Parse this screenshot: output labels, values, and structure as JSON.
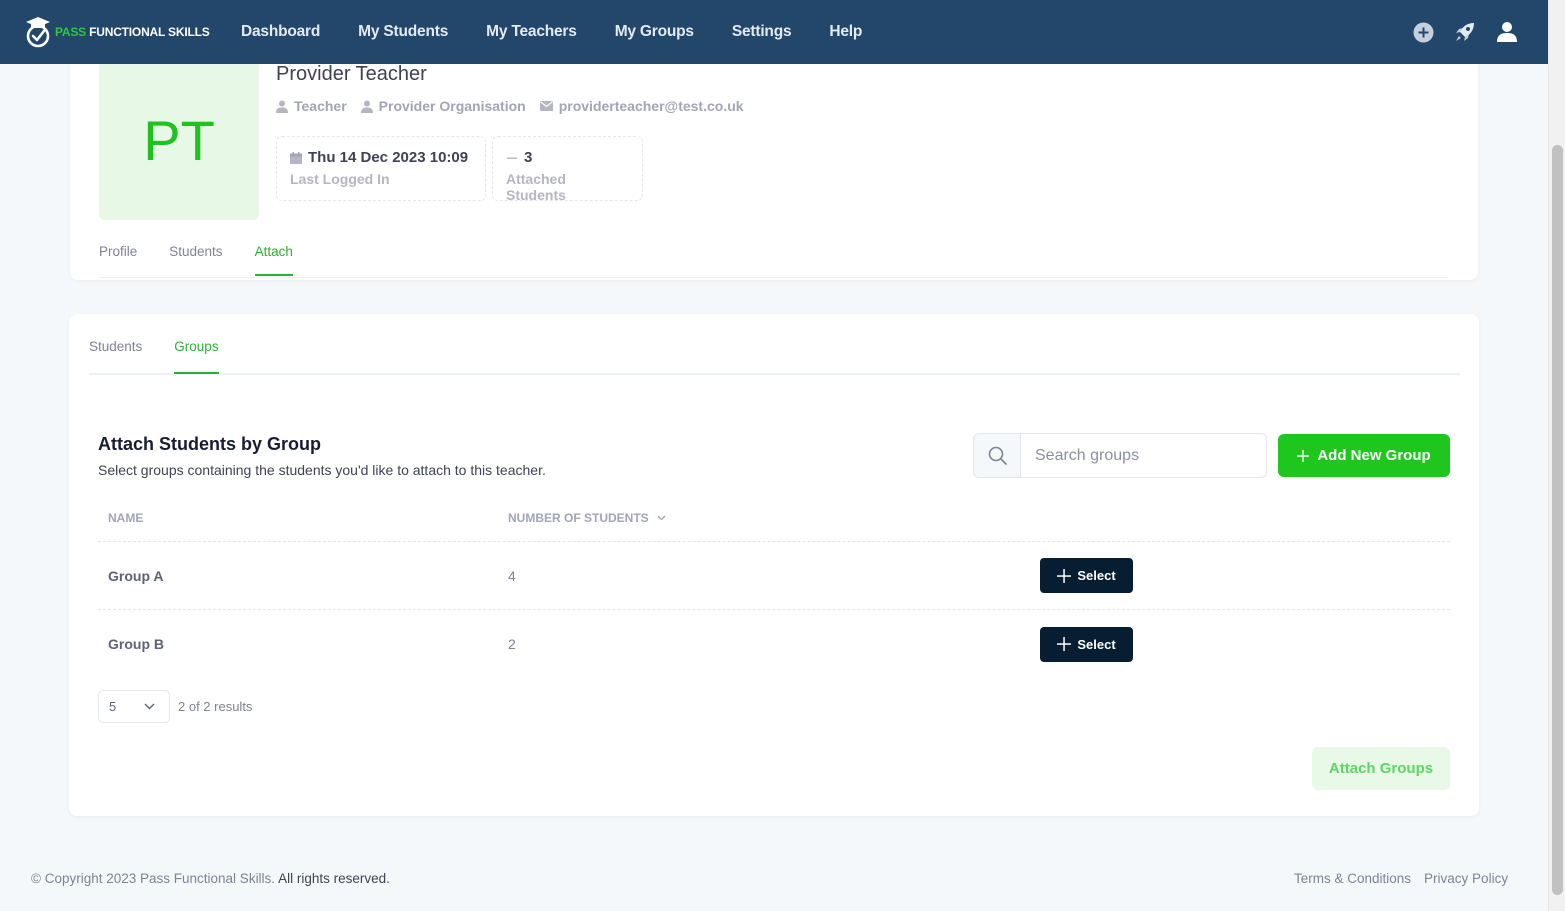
{
  "navbar": {
    "brand_accent": "PASS",
    "brand_rest": "FUNCTIONAL SKILLS",
    "items": [
      {
        "label": "Dashboard"
      },
      {
        "label": "My Students"
      },
      {
        "label": "My Teachers"
      },
      {
        "label": "My Groups"
      },
      {
        "label": "Settings"
      },
      {
        "label": "Help"
      }
    ],
    "icons": [
      "plus-circle-icon",
      "rocket-icon",
      "user-icon"
    ]
  },
  "profile": {
    "initials": "PT",
    "name": "Provider Teacher",
    "role": "Teacher",
    "organisation": "Provider Organisation",
    "email": "providerteacher@test.co.uk",
    "last_logged_in_value": "Thu 14 Dec 2023 10:09",
    "last_logged_in_label": "Last Logged In",
    "attached_students_value": "3",
    "attached_students_label": "Attached Students",
    "tabs": [
      "Profile",
      "Students",
      "Attach"
    ],
    "active_tab": "Attach"
  },
  "attach": {
    "tabs": [
      "Students",
      "Groups"
    ],
    "active_tab": "Groups",
    "title": "Attach Students by Group",
    "description": "Select groups containing the students you'd like to attach to this teacher.",
    "search_placeholder": "Search groups",
    "add_button": "Add New Group",
    "columns": {
      "name": "NAME",
      "students": "NUMBER OF STUDENTS"
    },
    "rows": [
      {
        "name": "Group A",
        "students": "4",
        "action": "Select"
      },
      {
        "name": "Group B",
        "students": "2",
        "action": "Select"
      }
    ],
    "page_size": "5",
    "results": "2 of 2 results",
    "attach_button": "Attach Groups"
  },
  "footer": {
    "copyright_prefix": "© Copyright 2023 Pass Functional Skills.",
    "copyright_suffix": " All rights reserved.",
    "links": [
      "Terms & Conditions",
      "Privacy Policy"
    ]
  },
  "colors": {
    "navbar": "#23466b",
    "accent_green": "#1fc61e",
    "dark_button": "#071d31"
  }
}
